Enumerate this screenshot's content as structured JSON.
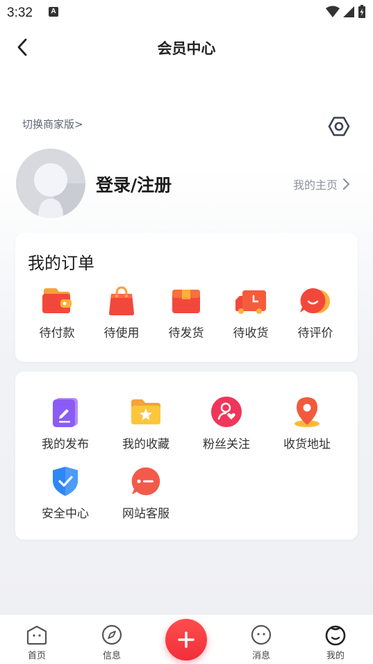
{
  "status_bar": {
    "time": "3:32",
    "notification_badge": "A"
  },
  "header": {
    "title": "会员中心"
  },
  "merchant": {
    "switch_label": "切换商家版>"
  },
  "profile": {
    "login_label": "登录/注册",
    "homepage_label": "我的主页"
  },
  "orders": {
    "title": "我的订单",
    "items": [
      {
        "label": "待付款",
        "icon": "wallet-icon",
        "color": "#f2463c"
      },
      {
        "label": "待使用",
        "icon": "shopping-bag-icon",
        "color": "#f2463c"
      },
      {
        "label": "待发货",
        "icon": "gift-box-icon",
        "color": "#f2463c"
      },
      {
        "label": "待收货",
        "icon": "delivery-truck-icon",
        "color": "#f2463c"
      },
      {
        "label": "待评价",
        "icon": "comment-bubble-icon",
        "color": "#f2463c"
      }
    ]
  },
  "tools": {
    "items": [
      {
        "label": "我的发布",
        "icon": "edit-note-icon",
        "color": "#8a5cf5"
      },
      {
        "label": "我的收藏",
        "icon": "star-folder-icon",
        "color": "#f7b52c"
      },
      {
        "label": "粉丝关注",
        "icon": "fans-heart-icon",
        "color": "#f0365a"
      },
      {
        "label": "收货地址",
        "icon": "location-pin-icon",
        "color": "#f25a3c"
      },
      {
        "label": "安全中心",
        "icon": "shield-check-icon",
        "color": "#2f86f5"
      },
      {
        "label": "网站客服",
        "icon": "chat-service-icon",
        "color": "#f25a4a"
      }
    ]
  },
  "tab_bar": {
    "tabs": [
      {
        "label": "首页",
        "icon": "home-icon"
      },
      {
        "label": "信息",
        "icon": "compass-icon"
      },
      {
        "label": "消息",
        "icon": "message-icon"
      },
      {
        "label": "我的",
        "icon": "profile-face-icon"
      }
    ],
    "active": "我的",
    "publish_icon": "plus-icon",
    "accent_color": "#f0363f"
  }
}
